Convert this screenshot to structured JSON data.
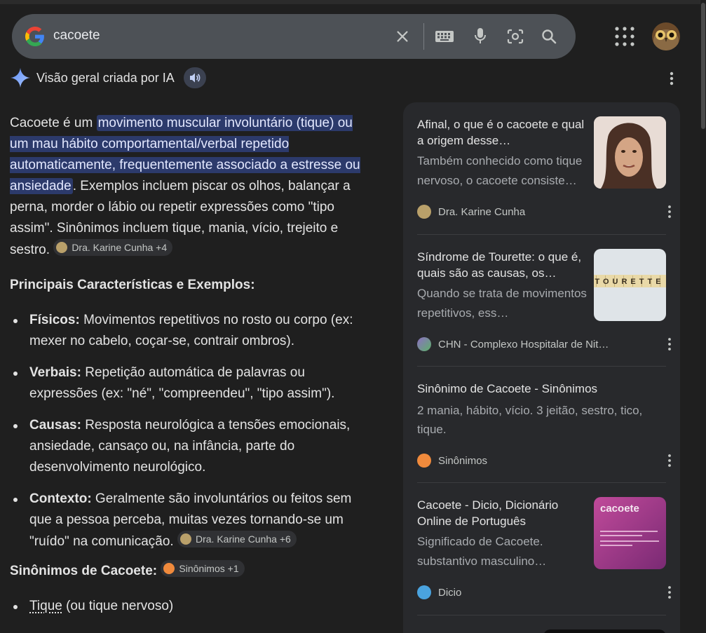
{
  "search": {
    "query": "cacoete"
  },
  "ai_overview": {
    "title": "Visão geral criada por IA",
    "intro_plain_start": "Cacoete é um ",
    "intro_highlight": "movimento muscular involuntário (tique) ou um mau hábito comportamental/verbal repetido automaticamente, frequentemente associado a estresse ou ansiedade",
    "intro_rest": ". Exemplos incluem piscar os olhos, balançar a perna, morder o lábio ou repetir expressões como \"tipo assim\". Sinônimos incluem tique, mania, vício, trejeito e sestro.",
    "intro_chip": "Dra. Karine Cunha +4",
    "characteristics_heading": "Principais Características e Exemplos:",
    "items": [
      {
        "label": "Físicos:",
        "text": " Movimentos repetitivos no rosto ou corpo (ex: mexer no cabelo, coçar-se, contrair ombros)."
      },
      {
        "label": "Verbais:",
        "text": " Repetição automática de palavras ou expressões (ex: \"né\", \"compreendeu\", \"tipo assim\")."
      },
      {
        "label": "Causas:",
        "text": " Resposta neurológica a tensões emocionais, ansiedade, cansaço ou, na infância, parte do desenvolvimento neurológico."
      },
      {
        "label": "Contexto:",
        "text": " Geralmente são involuntários ou feitos sem que a pessoa perceba, muitas vezes tornando-se um \"ruído\" na comunicação."
      }
    ],
    "context_chip": "Dra. Karine Cunha +6",
    "synonyms_heading": "Sinônimos de Cacoete:",
    "synonyms_chip": "Sinônimos +1",
    "synonym_first_link": "Tique",
    "synonym_first_rest": " (ou tique nervoso)"
  },
  "sources": [
    {
      "title": "Afinal, o que é o cacoete e qual a origem desse…",
      "snippet": "Também conhecido como tique nervoso, o cacoete consiste…",
      "source": "Dra. Karine Cunha",
      "icon_color": "#b9a06a"
    },
    {
      "title": "Síndrome de Tourette: o que é, quais são as causas, os…",
      "snippet": "Quando se trata de movimentos repetitivos, ess…",
      "source": "CHN - Complexo Hospitalar de Nit…",
      "icon_color": "#8e6fc4",
      "image_text": "TOURETTE"
    },
    {
      "title": "Sinônimo de Cacoete - Sinônimos",
      "snippet": "2 mania, hábito, vício. 3 jeitão, sestro, tico, tique.",
      "source": "Sinônimos",
      "icon_color": "#f08a3c"
    },
    {
      "title": "Cacoete - Dicio, Dicionário Online de Português",
      "snippet": "Significado de Cacoete. substantivo masculino…",
      "source": "Dicio",
      "icon_color": "#4aa3df",
      "image_text": "cacoete"
    }
  ],
  "colors": {
    "highlight": "#2c3a6b",
    "panel": "#28292c",
    "searchbar": "#4d5156"
  }
}
